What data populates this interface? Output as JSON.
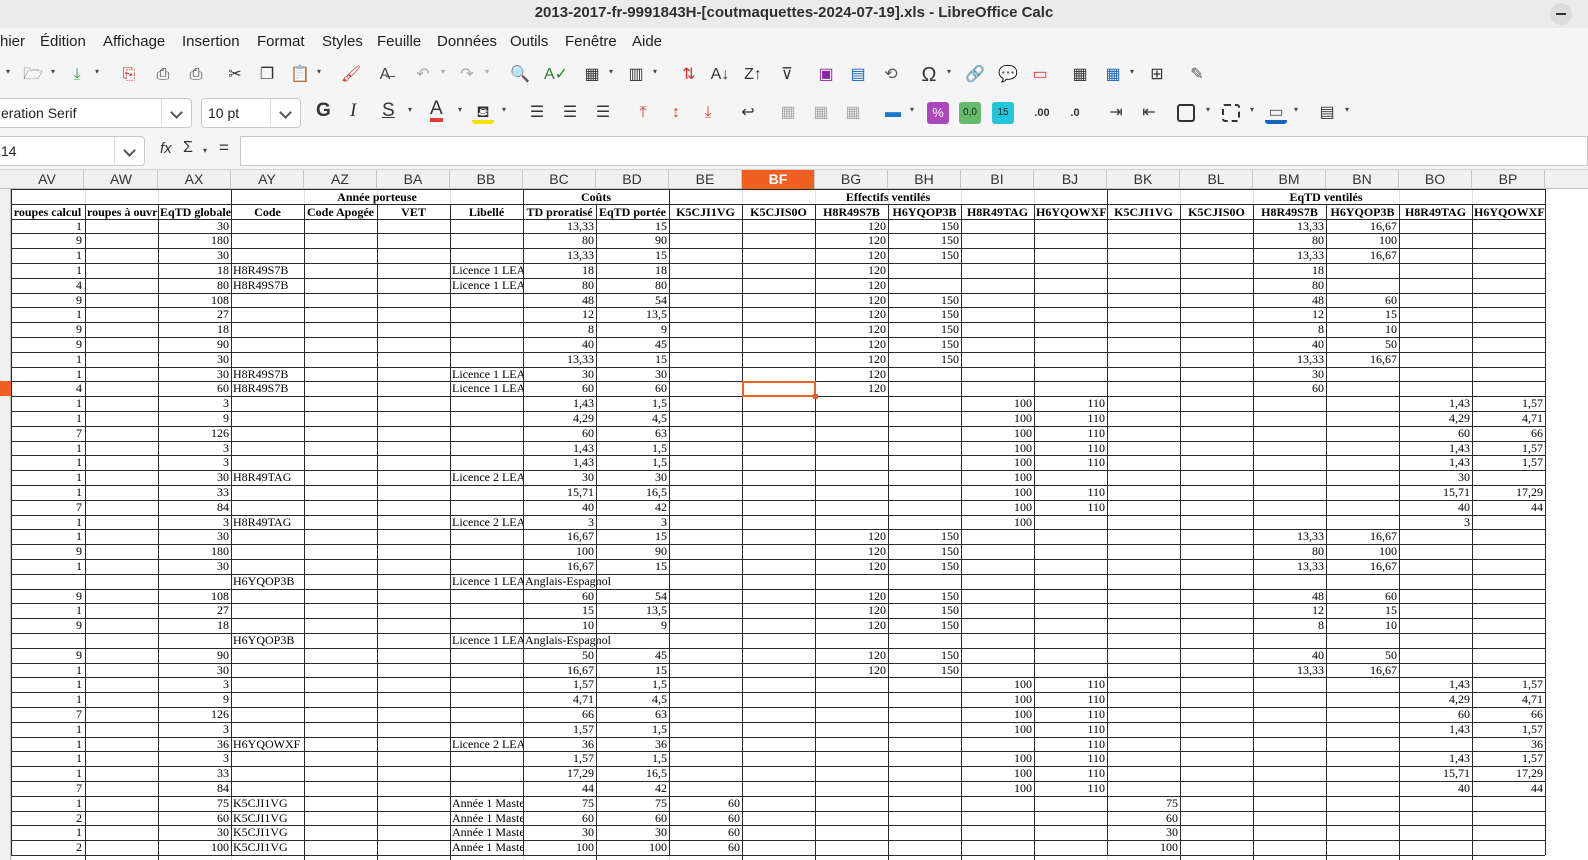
{
  "window": {
    "title": "2013-2017-fr-9991843H-[coutmaquettes-2024-07-19].xls - LibreOffice Calc"
  },
  "menu": [
    "hier",
    "Édition",
    "Affichage",
    "Insertion",
    "Format",
    "Styles",
    "Feuille",
    "Données",
    "Outils",
    "Fenêtre",
    "Aide"
  ],
  "toolbar": {
    "font_name": "eration Serif",
    "font_size": "10 pt",
    "bold": "G",
    "italic": "I",
    "strike": "S",
    "font_color": "A",
    "percent": "%",
    "num_fmt": "0,0",
    "add_decimal": ".00",
    "del_decimal": ".0"
  },
  "colors": {
    "accent": "#f15f22",
    "header_bg": "#f0f0f0",
    "toolbar_bg": "#f5f5f5"
  },
  "formula_bar": {
    "name_box": "14",
    "fx": "fx",
    "sum": "Σ",
    "equals": "=",
    "value": ""
  },
  "columns": [
    "AV",
    "AW",
    "AX",
    "AY",
    "AZ",
    "BA",
    "BB",
    "BC",
    "BD",
    "BE",
    "BF",
    "BG",
    "BH",
    "BI",
    "BJ",
    "BK",
    "BL",
    "BM",
    "BN",
    "BO",
    "BP"
  ],
  "active_column": "BF",
  "active_row_index": 11,
  "group_headers": {
    "annee": "Année porteuse",
    "couts": "Coûts",
    "effectifs": "Effectifs ventilés",
    "eqtd": "EqTD ventilés"
  },
  "field_headers": [
    "roupes calcul",
    "roupes à ouvr",
    "EqTD globale",
    "Code",
    "Code Apogée",
    "VET",
    "Libellé",
    "TD proratisé",
    "EqTD portée",
    "K5CJI1VG",
    "K5CJIS0O",
    "H8R49S7B",
    "H6YQOP3B",
    "H8R49TAG",
    "H6YQOWXF",
    "K5CJI1VG",
    "K5CJIS0O",
    "H8R49S7B",
    "H6YQOP3B",
    "H8R49TAG",
    "H6YQOWXF"
  ],
  "rows": [
    [
      "1",
      "",
      "30",
      "",
      "",
      "",
      "",
      "13,33",
      "15",
      "",
      "",
      "120",
      "150",
      "",
      "",
      "",
      "",
      "13,33",
      "16,67",
      "",
      ""
    ],
    [
      "9",
      "",
      "180",
      "",
      "",
      "",
      "",
      "80",
      "90",
      "",
      "",
      "120",
      "150",
      "",
      "",
      "",
      "",
      "80",
      "100",
      "",
      ""
    ],
    [
      "1",
      "",
      "30",
      "",
      "",
      "",
      "",
      "13,33",
      "15",
      "",
      "",
      "120",
      "150",
      "",
      "",
      "",
      "",
      "13,33",
      "16,67",
      "",
      ""
    ],
    [
      "1",
      "",
      "18",
      "H8R49S7B",
      "",
      "",
      "Licence 1 LEA",
      "18",
      "18",
      "",
      "",
      "120",
      "",
      "",
      "",
      "",
      "",
      "18",
      "",
      "",
      ""
    ],
    [
      "4",
      "",
      "80",
      "H8R49S7B",
      "",
      "",
      "Licence 1 LEA",
      "80",
      "80",
      "",
      "",
      "120",
      "",
      "",
      "",
      "",
      "",
      "80",
      "",
      "",
      ""
    ],
    [
      "9",
      "",
      "108",
      "",
      "",
      "",
      "",
      "48",
      "54",
      "",
      "",
      "120",
      "150",
      "",
      "",
      "",
      "",
      "48",
      "60",
      "",
      ""
    ],
    [
      "1",
      "",
      "27",
      "",
      "",
      "",
      "",
      "12",
      "13,5",
      "",
      "",
      "120",
      "150",
      "",
      "",
      "",
      "",
      "12",
      "15",
      "",
      ""
    ],
    [
      "9",
      "",
      "18",
      "",
      "",
      "",
      "",
      "8",
      "9",
      "",
      "",
      "120",
      "150",
      "",
      "",
      "",
      "",
      "8",
      "10",
      "",
      ""
    ],
    [
      "9",
      "",
      "90",
      "",
      "",
      "",
      "",
      "40",
      "45",
      "",
      "",
      "120",
      "150",
      "",
      "",
      "",
      "",
      "40",
      "50",
      "",
      ""
    ],
    [
      "1",
      "",
      "30",
      "",
      "",
      "",
      "",
      "13,33",
      "15",
      "",
      "",
      "120",
      "150",
      "",
      "",
      "",
      "",
      "13,33",
      "16,67",
      "",
      ""
    ],
    [
      "1",
      "",
      "30",
      "H8R49S7B",
      "",
      "",
      "Licence 1 LEA",
      "30",
      "30",
      "",
      "",
      "120",
      "",
      "",
      "",
      "",
      "",
      "30",
      "",
      "",
      ""
    ],
    [
      "4",
      "",
      "60",
      "H8R49S7B",
      "",
      "",
      "Licence 1 LEA",
      "60",
      "60",
      "",
      "",
      "120",
      "",
      "",
      "",
      "",
      "",
      "60",
      "",
      "",
      ""
    ],
    [
      "1",
      "",
      "3",
      "",
      "",
      "",
      "",
      "1,43",
      "1,5",
      "",
      "",
      "",
      "",
      "100",
      "110",
      "",
      "",
      "",
      "",
      "1,43",
      "1,57"
    ],
    [
      "1",
      "",
      "9",
      "",
      "",
      "",
      "",
      "4,29",
      "4,5",
      "",
      "",
      "",
      "",
      "100",
      "110",
      "",
      "",
      "",
      "",
      "4,29",
      "4,71"
    ],
    [
      "7",
      "",
      "126",
      "",
      "",
      "",
      "",
      "60",
      "63",
      "",
      "",
      "",
      "",
      "100",
      "110",
      "",
      "",
      "",
      "",
      "60",
      "66"
    ],
    [
      "1",
      "",
      "3",
      "",
      "",
      "",
      "",
      "1,43",
      "1,5",
      "",
      "",
      "",
      "",
      "100",
      "110",
      "",
      "",
      "",
      "",
      "1,43",
      "1,57"
    ],
    [
      "1",
      "",
      "3",
      "",
      "",
      "",
      "",
      "1,43",
      "1,5",
      "",
      "",
      "",
      "",
      "100",
      "110",
      "",
      "",
      "",
      "",
      "1,43",
      "1,57"
    ],
    [
      "1",
      "",
      "30",
      "H8R49TAG",
      "",
      "",
      "Licence 2 LEA",
      "30",
      "30",
      "",
      "",
      "",
      "",
      "100",
      "",
      "",
      "",
      "",
      "",
      "30",
      ""
    ],
    [
      "1",
      "",
      "33",
      "",
      "",
      "",
      "",
      "15,71",
      "16,5",
      "",
      "",
      "",
      "",
      "100",
      "110",
      "",
      "",
      "",
      "",
      "15,71",
      "17,29"
    ],
    [
      "7",
      "",
      "84",
      "",
      "",
      "",
      "",
      "40",
      "42",
      "",
      "",
      "",
      "",
      "100",
      "110",
      "",
      "",
      "",
      "",
      "40",
      "44"
    ],
    [
      "1",
      "",
      "3",
      "H8R49TAG",
      "",
      "",
      "Licence 2 LEA",
      "3",
      "3",
      "",
      "",
      "",
      "",
      "100",
      "",
      "",
      "",
      "",
      "",
      "3",
      ""
    ],
    [
      "1",
      "",
      "30",
      "",
      "",
      "",
      "",
      "16,67",
      "15",
      "",
      "",
      "120",
      "150",
      "",
      "",
      "",
      "",
      "13,33",
      "16,67",
      "",
      ""
    ],
    [
      "9",
      "",
      "180",
      "",
      "",
      "",
      "",
      "100",
      "90",
      "",
      "",
      "120",
      "150",
      "",
      "",
      "",
      "",
      "80",
      "100",
      "",
      ""
    ],
    [
      "1",
      "",
      "30",
      "",
      "",
      "",
      "",
      "16,67",
      "15",
      "",
      "",
      "120",
      "150",
      "",
      "",
      "",
      "",
      "13,33",
      "16,67",
      "",
      ""
    ],
    [
      "",
      "",
      "",
      "H6YQOP3B",
      "",
      "",
      "Licence 1 LEA",
      "Anglais-Espagnol",
      "",
      "",
      "",
      "",
      "",
      "",
      "",
      "",
      "",
      "",
      "",
      "",
      ""
    ],
    [
      "9",
      "",
      "108",
      "",
      "",
      "",
      "",
      "60",
      "54",
      "",
      "",
      "120",
      "150",
      "",
      "",
      "",
      "",
      "48",
      "60",
      "",
      ""
    ],
    [
      "1",
      "",
      "27",
      "",
      "",
      "",
      "",
      "15",
      "13,5",
      "",
      "",
      "120",
      "150",
      "",
      "",
      "",
      "",
      "12",
      "15",
      "",
      ""
    ],
    [
      "9",
      "",
      "18",
      "",
      "",
      "",
      "",
      "10",
      "9",
      "",
      "",
      "120",
      "150",
      "",
      "",
      "",
      "",
      "8",
      "10",
      "",
      ""
    ],
    [
      "",
      "",
      "",
      "H6YQOP3B",
      "",
      "",
      "Licence 1 LEA",
      "Anglais-Espagnol",
      "",
      "",
      "",
      "",
      "",
      "",
      "",
      "",
      "",
      "",
      "",
      "",
      ""
    ],
    [
      "9",
      "",
      "90",
      "",
      "",
      "",
      "",
      "50",
      "45",
      "",
      "",
      "120",
      "150",
      "",
      "",
      "",
      "",
      "40",
      "50",
      "",
      ""
    ],
    [
      "1",
      "",
      "30",
      "",
      "",
      "",
      "",
      "16,67",
      "15",
      "",
      "",
      "120",
      "150",
      "",
      "",
      "",
      "",
      "13,33",
      "16,67",
      "",
      ""
    ],
    [
      "1",
      "",
      "3",
      "",
      "",
      "",
      "",
      "1,57",
      "1,5",
      "",
      "",
      "",
      "",
      "100",
      "110",
      "",
      "",
      "",
      "",
      "1,43",
      "1,57"
    ],
    [
      "1",
      "",
      "9",
      "",
      "",
      "",
      "",
      "4,71",
      "4,5",
      "",
      "",
      "",
      "",
      "100",
      "110",
      "",
      "",
      "",
      "",
      "4,29",
      "4,71"
    ],
    [
      "7",
      "",
      "126",
      "",
      "",
      "",
      "",
      "66",
      "63",
      "",
      "",
      "",
      "",
      "100",
      "110",
      "",
      "",
      "",
      "",
      "60",
      "66"
    ],
    [
      "1",
      "",
      "3",
      "",
      "",
      "",
      "",
      "1,57",
      "1,5",
      "",
      "",
      "",
      "",
      "100",
      "110",
      "",
      "",
      "",
      "",
      "1,43",
      "1,57"
    ],
    [
      "1",
      "",
      "36",
      "H6YQOWXF",
      "",
      "",
      "Licence 2 LEA",
      "36",
      "36",
      "",
      "",
      "",
      "",
      "",
      "110",
      "",
      "",
      "",
      "",
      "",
      "36"
    ],
    [
      "1",
      "",
      "3",
      "",
      "",
      "",
      "",
      "1,57",
      "1,5",
      "",
      "",
      "",
      "",
      "100",
      "110",
      "",
      "",
      "",
      "",
      "1,43",
      "1,57"
    ],
    [
      "1",
      "",
      "33",
      "",
      "",
      "",
      "",
      "17,29",
      "16,5",
      "",
      "",
      "",
      "",
      "100",
      "110",
      "",
      "",
      "",
      "",
      "15,71",
      "17,29"
    ],
    [
      "7",
      "",
      "84",
      "",
      "",
      "",
      "",
      "44",
      "42",
      "",
      "",
      "",
      "",
      "100",
      "110",
      "",
      "",
      "",
      "",
      "40",
      "44"
    ],
    [
      "1",
      "",
      "75",
      "K5CJI1VG",
      "",
      "",
      "Année 1 Maste",
      "75",
      "75",
      "60",
      "",
      "",
      "",
      "",
      "",
      "75",
      "",
      "",
      "",
      "",
      ""
    ],
    [
      "2",
      "",
      "60",
      "K5CJI1VG",
      "",
      "",
      "Année 1 Maste",
      "60",
      "60",
      "60",
      "",
      "",
      "",
      "",
      "",
      "60",
      "",
      "",
      "",
      "",
      ""
    ],
    [
      "1",
      "",
      "30",
      "K5CJI1VG",
      "",
      "",
      "Année 1 Maste",
      "30",
      "30",
      "60",
      "",
      "",
      "",
      "",
      "",
      "30",
      "",
      "",
      "",
      "",
      ""
    ],
    [
      "2",
      "",
      "100",
      "K5CJI1VG",
      "",
      "",
      "Année 1 Maste",
      "100",
      "100",
      "60",
      "",
      "",
      "",
      "",
      "",
      "100",
      "",
      "",
      "",
      "",
      ""
    ]
  ]
}
